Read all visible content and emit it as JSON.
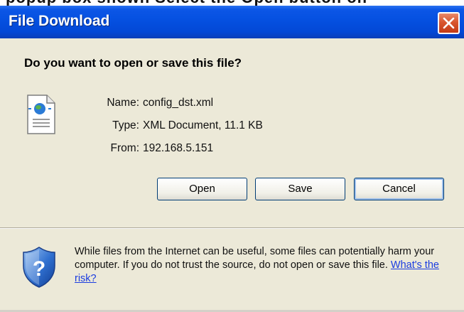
{
  "background_text": "popup box shown Select the Open button on",
  "window": {
    "title": "File Download",
    "titlebar_color": "#0550e0",
    "close_color": "#d9562f"
  },
  "dialog": {
    "heading": "Do you want to open or save this file?",
    "file": {
      "name_label": "Name:",
      "name_value": "config_dst.xml",
      "type_label": "Type:",
      "type_value": "XML Document, 11.1 KB",
      "from_label": "From:",
      "from_value": "192.168.5.151",
      "icon": "xml-document-icon"
    },
    "buttons": {
      "open": "Open",
      "save": "Save",
      "cancel": "Cancel"
    },
    "warning": {
      "text": "While files from the Internet can be useful, some files can potentially harm your computer. If you do not trust the source, do not open or save this file.",
      "link": "What's the risk?",
      "icon": "security-shield-icon"
    }
  }
}
